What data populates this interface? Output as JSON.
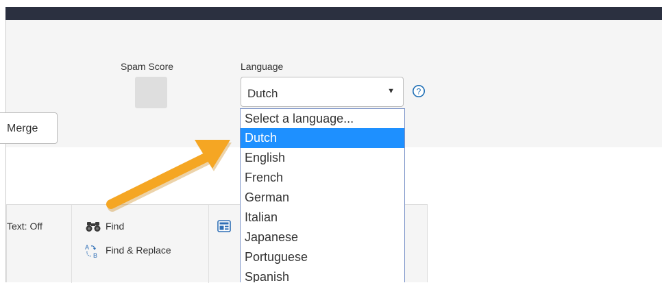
{
  "spam_score": {
    "label": "Spam Score",
    "value": ""
  },
  "language": {
    "label": "Language",
    "selected": "Dutch",
    "arrow_glyph": "▼",
    "help_glyph": "?",
    "options": [
      {
        "label": "Select a language...",
        "placeholder": true
      },
      {
        "label": "Dutch",
        "selected": true
      },
      {
        "label": "English"
      },
      {
        "label": "French"
      },
      {
        "label": "German"
      },
      {
        "label": "Italian"
      },
      {
        "label": "Japanese"
      },
      {
        "label": "Portuguese"
      },
      {
        "label": "Spanish"
      }
    ]
  },
  "merge_button": {
    "label": "Merge"
  },
  "toolbar": {
    "plaintext_label": "Text: Off",
    "find_label": "Find",
    "find_replace_label": "Find & Replace",
    "icons": {
      "find": "binoculars-icon",
      "find_replace": "find-replace-icon",
      "template": "template-icon"
    }
  },
  "colors": {
    "top_bar": "#2b3040",
    "panel_bg": "#f5f5f5",
    "selected_option": "#1e90ff",
    "help_icon": "#1f6fb5",
    "arrow_annotation": "#f5a623"
  }
}
